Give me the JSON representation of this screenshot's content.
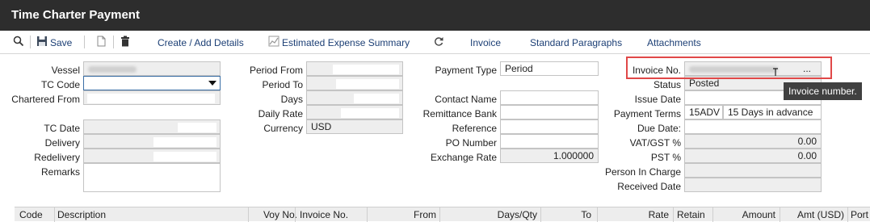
{
  "window": {
    "title": "Time Charter Payment"
  },
  "toolbar": {
    "save": "Save",
    "create": "Create / Add Details",
    "estimated": "Estimated Expense Summary",
    "invoice": "Invoice",
    "paragraphs": "Standard Paragraphs",
    "attachments": "Attachments"
  },
  "left": {
    "vessel": "Vessel",
    "tc_code": "TC Code",
    "chartered_from": "Chartered From",
    "tc_date": "TC Date",
    "delivery": "Delivery",
    "redelivery": "Redelivery",
    "remarks": "Remarks"
  },
  "middle": {
    "period_from": "Period From",
    "period_to": "Period To",
    "days": "Days",
    "daily_rate": "Daily Rate",
    "currency": "Currency",
    "currency_value": "USD"
  },
  "payment": {
    "payment_type": "Payment Type",
    "payment_type_value": "Period",
    "contact_name": "Contact Name",
    "remittance_bank": "Remittance Bank",
    "reference": "Reference",
    "po_number": "PO Number",
    "exchange_rate": "Exchange Rate",
    "exchange_rate_value": "1.000000"
  },
  "right": {
    "invoice_no": "Invoice No.",
    "invoice_more": "...",
    "status": "Status",
    "status_value": "Posted",
    "issue_date": "Issue Date",
    "payment_terms": "Payment Terms",
    "terms_code": "15ADV",
    "terms_desc": "15 Days in advance",
    "due_date": "Due Date:",
    "vat": "VAT/GST %",
    "vat_value": "0.00",
    "pst": "PST %",
    "pst_value": "0.00",
    "person": "Person In Charge",
    "received": "Received Date",
    "tooltip": "Invoice number."
  },
  "grid": {
    "columns": [
      "Code",
      "Description",
      "Voy No.",
      "Invoice No.",
      "From",
      "Days/Qty",
      "To",
      "Rate",
      "Retain",
      "Amount",
      "Amt (USD)",
      "Port"
    ]
  },
  "icons": [
    "search-icon",
    "save-icon",
    "document-icon",
    "trash-icon",
    "chart-icon",
    "refresh-icon",
    "chevron-down-icon",
    "text-cursor-icon"
  ]
}
